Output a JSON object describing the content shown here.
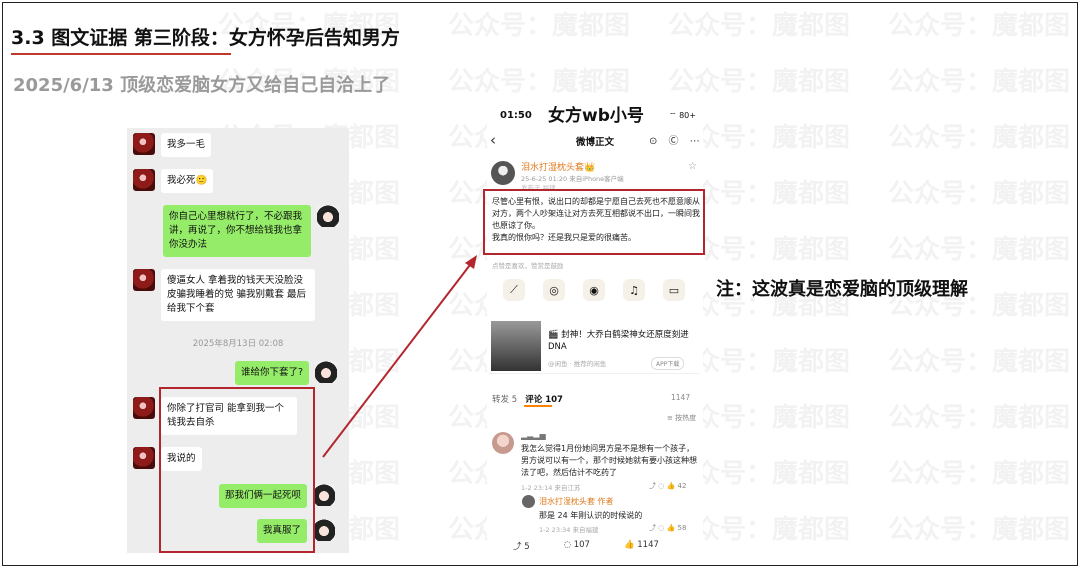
{
  "header": {
    "title": "3.3 图文证据 第三阶段：女方怀孕后告知男方",
    "subtitle": "2025/6/13 顶级恋爱脑女方又给自己自洽上了"
  },
  "watermark": {
    "text": "公众号：魔都图"
  },
  "chat": {
    "messages": [
      {
        "side": "left",
        "text": "我多一毛"
      },
      {
        "side": "left",
        "text": "我必死🙂"
      },
      {
        "side": "right",
        "text": "你自己心里想就行了，不必跟我讲，再说了，你不想给钱我也拿你没办法"
      },
      {
        "side": "left",
        "text": "傻逼女人 拿着我的钱天天没脸没皮骗我睡着的觉 骗我别戴套 最后给我下个套"
      },
      {
        "side": "right",
        "text": "谁给你下套了?"
      },
      {
        "side": "left",
        "text": "你除了打官司 能拿到我一个钱我去自杀"
      },
      {
        "side": "left",
        "text": "我说的"
      },
      {
        "side": "right",
        "text": "那我们俩一起死呗"
      },
      {
        "side": "right",
        "text": "我真服了"
      }
    ],
    "timestamp": "2025年8月13日 02:08"
  },
  "phone": {
    "label": "女方wb小号",
    "status_time": "01:50",
    "status_icons": "⌔ 80+",
    "nav_title": "微博正文",
    "nav_icons": "⊙ Ⓒ ⋯",
    "post": {
      "author": "泪水打湿枕头套👑",
      "meta": "25-6-25 01:20  来自iPhone客户端",
      "meta2": "发布于 福建",
      "text": "尽管心里有恨，说出口的却都是宁愿自己去死也不愿意顺从对方，两个人吵架连让对方去死互相都说不出口，一瞬间我也原谅了你。\n我真的恨你吗？还是我只是爱的很痛苦。",
      "footnote": "点赞是喜欢，赞赏是鼓励"
    },
    "share_icons": [
      "⟋",
      "◎",
      "◉",
      "♫",
      "▭"
    ],
    "ad": {
      "title": "🎬 封神！大乔白鹤梁神女还原度刻进DNA",
      "source": "@闲鱼 · 推荐的闲鱼",
      "button": "APP下载"
    },
    "tabs": {
      "repost": "转发 5",
      "comments": "评论 107",
      "likes": "1147",
      "sort": "≡ 按热度"
    },
    "comment": {
      "author": "▂▃▂▅",
      "text": "我怎么觉得1月份她问男方是不是想有一个孩子，男方说可以有一个，那个时候她就有要小孩这种想法了吧，然后估计不吃药了",
      "meta": "1-2 23:14  来自江苏",
      "actions": "⤴  ◌  👍 42"
    },
    "reply": {
      "author": "泪水打湿枕头套 作者",
      "text": "那是 24 年刚认识的时候说的",
      "meta": "1-2 23:34  来自福建",
      "actions": "⤴  ◌  👍 58"
    },
    "bottom": {
      "share": "⤴ 5",
      "comment": "◌ 107",
      "like": "👍 1147"
    }
  },
  "note": "注：这波真是恋爱脑的顶级理解",
  "colors": {
    "accent_red": "#b3262d",
    "wechat_green": "#95ec69",
    "weibo_orange": "#e07b1f"
  }
}
